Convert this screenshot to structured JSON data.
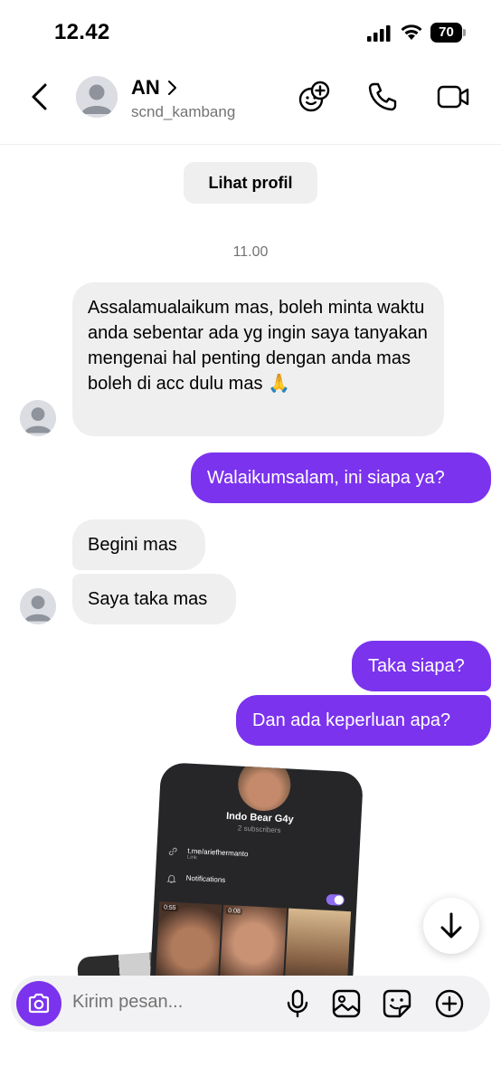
{
  "status_bar": {
    "time": "12.42",
    "battery": "70"
  },
  "header": {
    "contact_name": "AN",
    "username": "scnd_kambang"
  },
  "profile_button": "Lihat profil",
  "timestamp": "11.00",
  "messages": [
    {
      "side": "in",
      "text": "Assalamualaikum mas, boleh minta waktu anda sebentar ada yg ingin saya tanyakan mengenai hal penting dengan anda mas boleh di acc dulu mas 🙏"
    },
    {
      "side": "out",
      "text": "Walaikumsalam, ini siapa ya?"
    },
    {
      "side": "in",
      "text": "Begini mas"
    },
    {
      "side": "in",
      "text": "Saya taka mas"
    },
    {
      "side": "out",
      "text": "Taka siapa?"
    },
    {
      "side": "out",
      "text": "Dan ada keperluan apa?"
    }
  ],
  "shared_photo": {
    "channel_name": "Indo Bear G4y",
    "subscribers": "2 subscribers",
    "link": "t.me/ariefhermanto",
    "link_label": "Link",
    "notifications": "Notifications",
    "thumb_durations": [
      "0:55",
      "0:08"
    ]
  },
  "composer": {
    "placeholder": "Kirim pesan..."
  },
  "colors": {
    "accent": "#7b33ee",
    "bubble_in": "#efefef"
  },
  "icons": [
    "back-icon",
    "chevron-right-icon",
    "sticker-effects-icon",
    "phone-icon",
    "video-icon",
    "arrow-down-icon",
    "camera-icon",
    "microphone-icon",
    "gallery-icon",
    "sticker-icon",
    "plus-icon"
  ]
}
